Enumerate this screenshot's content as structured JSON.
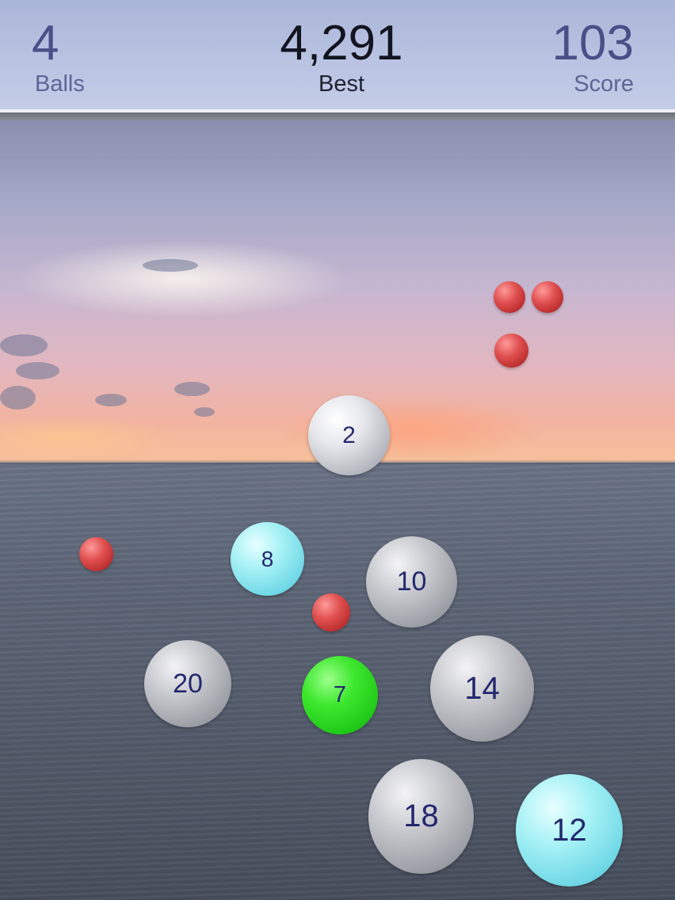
{
  "hud": {
    "balls": {
      "value": "4",
      "label": "Balls"
    },
    "best": {
      "value": "4,291",
      "label": "Best"
    },
    "score": {
      "value": "103",
      "label": "Score"
    }
  },
  "numbered_balls": [
    {
      "number": "2",
      "color": "white"
    },
    {
      "number": "8",
      "color": "cyan"
    },
    {
      "number": "10",
      "color": "gray"
    },
    {
      "number": "20",
      "color": "gray"
    },
    {
      "number": "7",
      "color": "green"
    },
    {
      "number": "14",
      "color": "gray"
    },
    {
      "number": "18",
      "color": "gray"
    },
    {
      "number": "12",
      "color": "cyan"
    }
  ],
  "red_ball_count": 5,
  "colors": {
    "hud_background": "#b9c3e2",
    "stat_color": "#4a4f88",
    "best_color": "#121420",
    "ball_number_color": "#24286e",
    "red_ball": "#d04444",
    "green_ball": "#3ee82e",
    "cyan_ball": "#a8f2f6"
  }
}
